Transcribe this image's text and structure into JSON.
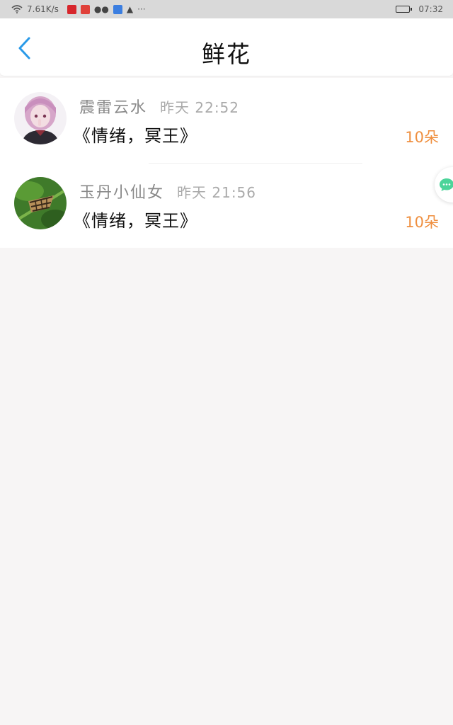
{
  "status_bar": {
    "speed": "7.61K/s",
    "more": "···",
    "time": "07:32"
  },
  "header": {
    "title": "鲜花"
  },
  "records": [
    {
      "username": "震雷云水",
      "time": "昨天 22:52",
      "book": "《情绪，冥王》",
      "count": "10朵",
      "avatar_icon": "anime-girl-avatar"
    },
    {
      "username": "玉丹小仙女",
      "time": "昨天 21:56",
      "book": "《情绪，冥王》",
      "count": "10朵",
      "avatar_icon": "butterfly-avatar"
    }
  ],
  "colors": {
    "accent": "#2a9ae8",
    "count": "#ef8f3f",
    "chat_green": "#4cd49a"
  }
}
